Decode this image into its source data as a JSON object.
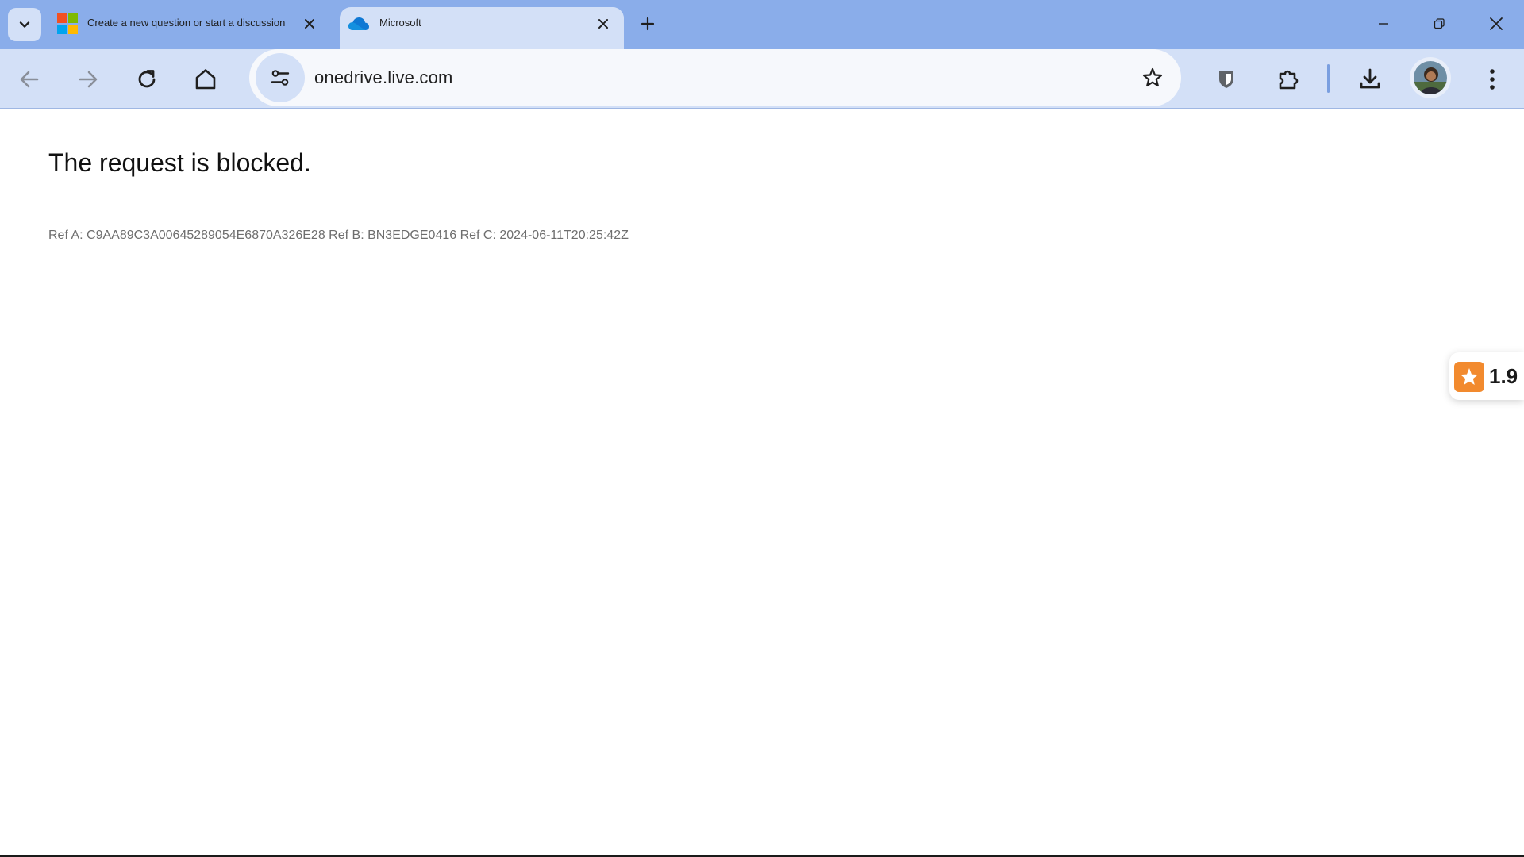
{
  "tabs": [
    {
      "title": "Create a new question or start a discussion",
      "favicon": "microsoft-logo-icon",
      "active": false
    },
    {
      "title": "Microsoft",
      "favicon": "onedrive-cloud-icon",
      "active": true
    }
  ],
  "omnibox": {
    "url": "onedrive.live.com"
  },
  "page": {
    "heading": "The request is blocked.",
    "refs": "Ref A: C9AA89C3A00645289054E6870A326E28 Ref B: BN3EDGE0416 Ref C: 2024-06-11T20:25:42Z"
  },
  "rating_widget": {
    "value": "1.9",
    "icon": "star-icon",
    "color": "#f28a2e"
  },
  "theme": {
    "tabstrip_bg": "#8aadea",
    "toolbar_bg": "#d3e0f7",
    "omnibox_bg": "#f6f8fc"
  }
}
